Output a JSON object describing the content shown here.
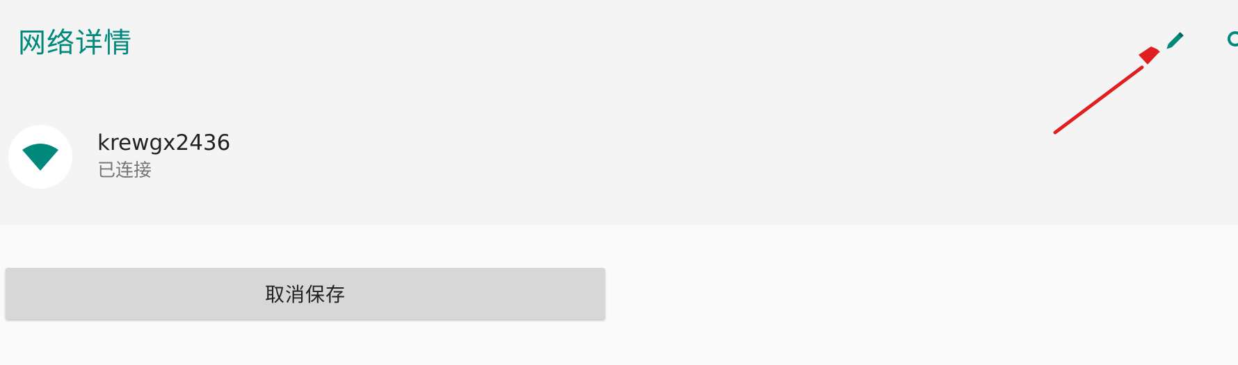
{
  "header": {
    "title": "网络详情"
  },
  "actions": {
    "edit_icon": "pencil-icon",
    "edge_icon": "search-icon"
  },
  "network": {
    "icon": "wifi-icon",
    "name": "krewgx2436",
    "status": "已连接"
  },
  "buttons": {
    "forget_label": "取消保存"
  },
  "colors": {
    "accent": "#00897b",
    "annotation": "#e02020"
  }
}
